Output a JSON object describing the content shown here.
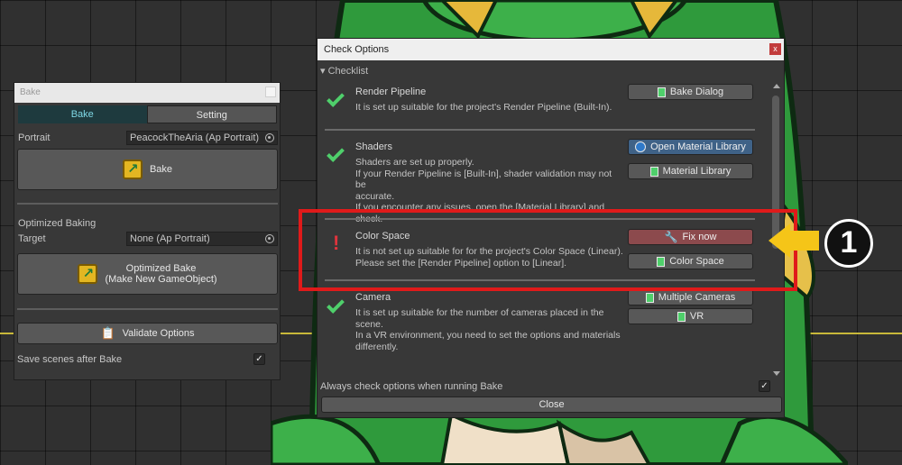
{
  "bake_window": {
    "title": "Bake",
    "tabs": [
      "Bake",
      "Setting"
    ],
    "active_tab": "Bake",
    "portrait_label": "Portrait",
    "portrait_value": "PeacockTheAria (Ap Portrait)",
    "bake_button": "Bake",
    "optimized_baking_label": "Optimized Baking",
    "target_label": "Target",
    "target_value": "None (Ap Portrait)",
    "optimized_bake_button_line1": "Optimized Bake",
    "optimized_bake_button_line2": "(Make New GameObject)",
    "validate_button": "Validate Options",
    "save_scenes_label": "Save scenes after Bake",
    "save_scenes_checked": "✓"
  },
  "check_window": {
    "title": "Check Options",
    "close_x": "x",
    "checklist_header": "Checklist",
    "items": [
      {
        "title": "Render Pipeline",
        "status": "ok",
        "desc": [
          "It is set up suitable for the project's Render Pipeline (Built-In)."
        ],
        "buttons": [
          "Bake Dialog"
        ]
      },
      {
        "title": "Shaders",
        "status": "ok",
        "desc": [
          "Shaders are set up properly.",
          "If your Render Pipeline is [Built-In], shader validation may not be",
          "accurate.",
          "If you encounter any issues, open the [Material Library] and",
          "check."
        ],
        "buttons": [
          "Open Material Library",
          "Material Library"
        ]
      },
      {
        "title": "Color Space",
        "status": "warning",
        "desc": [
          "It is not set up suitable for for the project's Color Space (Linear).",
          "Please set the [Render Pipeline] option to [Linear]."
        ],
        "buttons": [
          "Fix now",
          "Color Space"
        ]
      },
      {
        "title": "Camera",
        "status": "ok",
        "desc": [
          "It is set up suitable for the number of cameras placed in the",
          "scene.",
          "In a VR environment, you need to set the options and materials",
          "differently."
        ],
        "buttons": [
          "Multiple Cameras",
          "VR"
        ]
      }
    ],
    "always_check_label": "Always check options when running Bake",
    "always_check_checked": "✓",
    "close_button": "Close"
  },
  "annotation": {
    "badge_number": "1",
    "highlight_color": "#e01a1a",
    "arrow_color": "#f5c518"
  },
  "colors": {
    "ok": "#4fcf6b",
    "warning": "#e0343d",
    "active_tab_bg": "#1e3a3e",
    "primary_button": "#3f6287",
    "fix_button": "#8c4a4d"
  }
}
